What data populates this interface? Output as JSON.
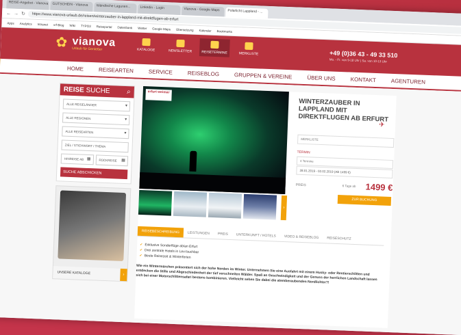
{
  "background": {
    "year_text": "2019",
    "accent": "#f2a20a",
    "brand": "#b8323e"
  },
  "browser": {
    "tabs": [
      "REISE-Angebot - Vianova",
      "GUTSCHEIN - Vianova",
      "Isländische Lagunen...",
      "Linkedin - Login",
      "Vianova - Google Maps",
      "Polarlicht Lappland - ..."
    ],
    "url": "https://www.vianova-urlaub.de/reisen/winterzauber-in-lappland-mit-direktflugen-ab-erfurt",
    "bookmarks": [
      "Apps",
      "Analytics",
      "Intranet",
      "vrf-Blog",
      "Wiki",
      "TYPO3",
      "Reiseportal",
      "Datenbank",
      "Wetter",
      "Google Maps",
      "Übersetzung",
      "Kalender",
      "Bookmarks"
    ]
  },
  "header": {
    "logo_name": "vianova",
    "logo_tag": "Urlaub für Genießer",
    "items": [
      {
        "label": "KATALOGE"
      },
      {
        "label": "NEWSLETTER"
      },
      {
        "label": "REISETERMINE"
      },
      {
        "label": "MERKLISTE"
      }
    ],
    "phone": "+49 (0)36 43 - 49 33 510",
    "hours": "Mo. - Fr. von 9-18 Uhr | Sa. von 10-13 Uhr"
  },
  "mainnav": [
    "HOME",
    "REISEARTEN",
    "SERVICE",
    "REISEBLOG",
    "GRUPPEN & VEREINE",
    "ÜBER UNS",
    "KONTAKT",
    "AGENTUREN"
  ],
  "search": {
    "title_bold": "REISE",
    "title_light": "SUCHE",
    "selects": [
      "ALLE REISELÄNDER",
      "ALLE REGIONEN",
      "ALLE REISEARTEN"
    ],
    "keyword_placeholder": "ZIEL / STICHWORT / THEMA",
    "date_from": "HINREISE AB",
    "date_to": "RÜCKREISE",
    "submit": "SUCHE ABSCHICKEN"
  },
  "catalog": {
    "label": "UNSERE KATALOGE",
    "arrow": "›"
  },
  "offer": {
    "badge": "erfurt weimar",
    "title": "WINTERZAUBER IN LAPPLAND MIT DIREKTFLUGEN AB ERFURT",
    "merkliste": "MERKLISTE",
    "termin_label": "TERMIN",
    "termin_placeholder": "4 Termine",
    "termin_selected": "28.01.2019 - 02.02.2019 (AB 1499 €)",
    "preis_label": "PREIS",
    "preis_note": "6 Tage ab",
    "preis_value": "1499 €",
    "book_button": "ZUR BUCHUNG"
  },
  "detail_tabs": [
    "REISEBESCHREIBUNG",
    "LEISTUNGEN",
    "PREIS",
    "UNTERKUNFT / HOTELS",
    "VIDEO & REISEBLOG",
    "REISESCHUTZ"
  ],
  "bullets": [
    "Exklusive Sonderflüge ab/an Erfurt",
    "Drei zentrale Hotels in Levi buchbar",
    "Beste Reisezeit & Winterferien"
  ],
  "description": "Wie ein Wintermärchen präsentiert sich der hohe Norden im Winter. Unternehmen Sie eine Ausfahrt mit einem Husky- oder Rentierschlitten und entdecken die Stille und Abgeschiedenheit der tief verschneiten Wälder. Spaß an Geschwindigkeit und der Genuss der herrlichen Landschaft lassen sich bei einer Motorschlittensafari bestens kombinieren. Vielleicht sehen Sie dabei die atemberaubenden Nordlichter?!"
}
